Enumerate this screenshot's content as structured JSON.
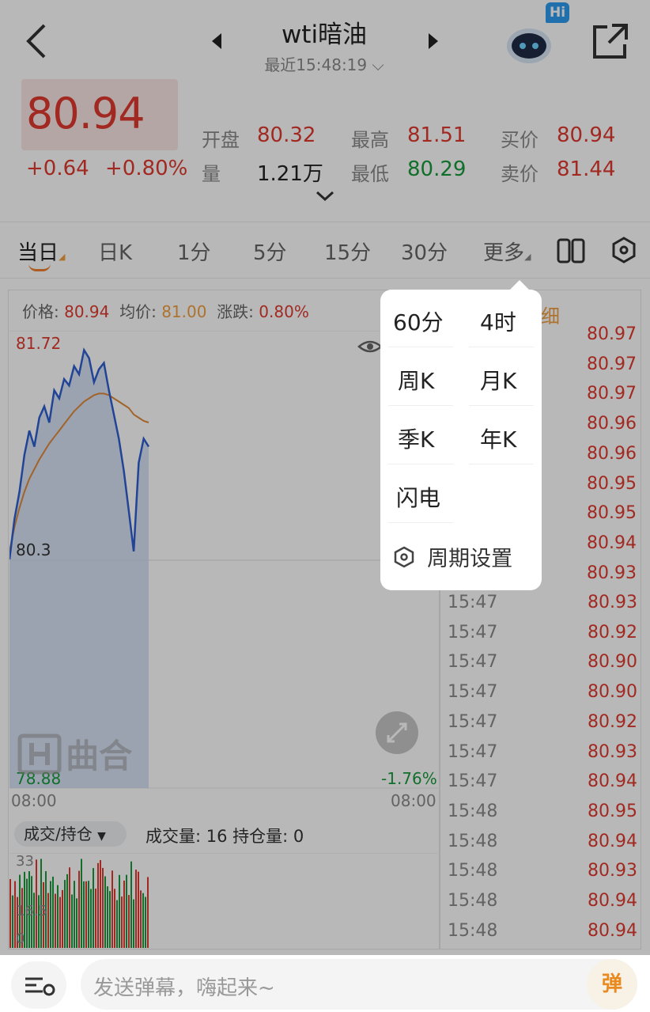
{
  "header": {
    "title": "wti暗油",
    "subtitle": "最近15:48:19",
    "badge": "Hi"
  },
  "quote": {
    "price": "80.94",
    "change": "+0.64",
    "change_pct": "+0.80%",
    "open_label": "开盘",
    "open": "80.32",
    "volume_label": "量",
    "volume": "1.21万",
    "high_label": "最高",
    "high": "81.51",
    "low_label": "最低",
    "low": "80.29",
    "bid_label": "买价",
    "bid": "80.94",
    "ask_label": "卖价",
    "ask": "81.44"
  },
  "tabs": [
    "当日",
    "日K",
    "1分",
    "5分",
    "15分",
    "30分",
    "更多"
  ],
  "info": {
    "price_label": "价格:",
    "price": "80.94",
    "avg_label": "均价:",
    "avg": "81.00",
    "chg_label": "涨跌:",
    "chg": "0.80%"
  },
  "chart": {
    "y_top": "81.72",
    "y_mid": "80.3",
    "y_bottom": "78.88",
    "pct_bottom": "-1.76%",
    "x_start": "08:00",
    "x_end": "08:00",
    "watermark": "曲合",
    "vol_selector": "成交/持仓",
    "vol_info": "成交量: 16 持仓量: 0",
    "vol_axis_top": "33",
    "vol_axis_mid": "16.5",
    "vol_axis_zero": "0",
    "price_series": [
      80.3,
      80.55,
      80.72,
      80.95,
      81.1,
      81.0,
      81.18,
      81.25,
      81.15,
      81.35,
      81.3,
      81.42,
      81.38,
      81.5,
      81.45,
      81.6,
      81.55,
      81.4,
      81.48,
      81.52,
      81.35,
      81.2,
      81.05,
      80.85,
      80.6,
      80.35,
      80.9,
      81.05,
      81.0
    ],
    "avg_series": [
      80.35,
      80.5,
      80.62,
      80.72,
      80.8,
      80.86,
      80.92,
      80.97,
      81.02,
      81.06,
      81.1,
      81.14,
      81.18,
      81.22,
      81.25,
      81.28,
      81.3,
      81.32,
      81.33,
      81.33,
      81.32,
      81.3,
      81.28,
      81.26,
      81.24,
      81.2,
      81.18,
      81.16,
      81.15
    ]
  },
  "ticks_header": "细",
  "ticks_top": [
    "80.97",
    "80.97",
    "80.97",
    "80.96",
    "80.96",
    "80.95",
    "80.95",
    "80.94",
    "80.93"
  ],
  "ticks": [
    {
      "time": "15:47",
      "price": "80.93"
    },
    {
      "time": "15:47",
      "price": "80.92"
    },
    {
      "time": "15:47",
      "price": "80.90"
    },
    {
      "time": "15:47",
      "price": "80.90"
    },
    {
      "time": "15:47",
      "price": "80.92"
    },
    {
      "time": "15:47",
      "price": "80.93"
    },
    {
      "time": "15:47",
      "price": "80.94"
    },
    {
      "time": "15:48",
      "price": "80.95"
    },
    {
      "time": "15:48",
      "price": "80.94"
    },
    {
      "time": "15:48",
      "price": "80.93"
    },
    {
      "time": "15:48",
      "price": "80.94"
    },
    {
      "time": "15:48",
      "price": "80.94"
    }
  ],
  "popup": {
    "items": [
      "60分",
      "4时",
      "周K",
      "月K",
      "季K",
      "年K",
      "闪电"
    ],
    "settings": "周期设置"
  },
  "bottom": {
    "placeholder": "发送弹幕，嗨起来~",
    "danmu_button": "弹"
  },
  "colors": {
    "up": "#e03a2f",
    "down": "#1a9a3c",
    "accent": "#f0a040",
    "line": "#2f5fd0"
  }
}
